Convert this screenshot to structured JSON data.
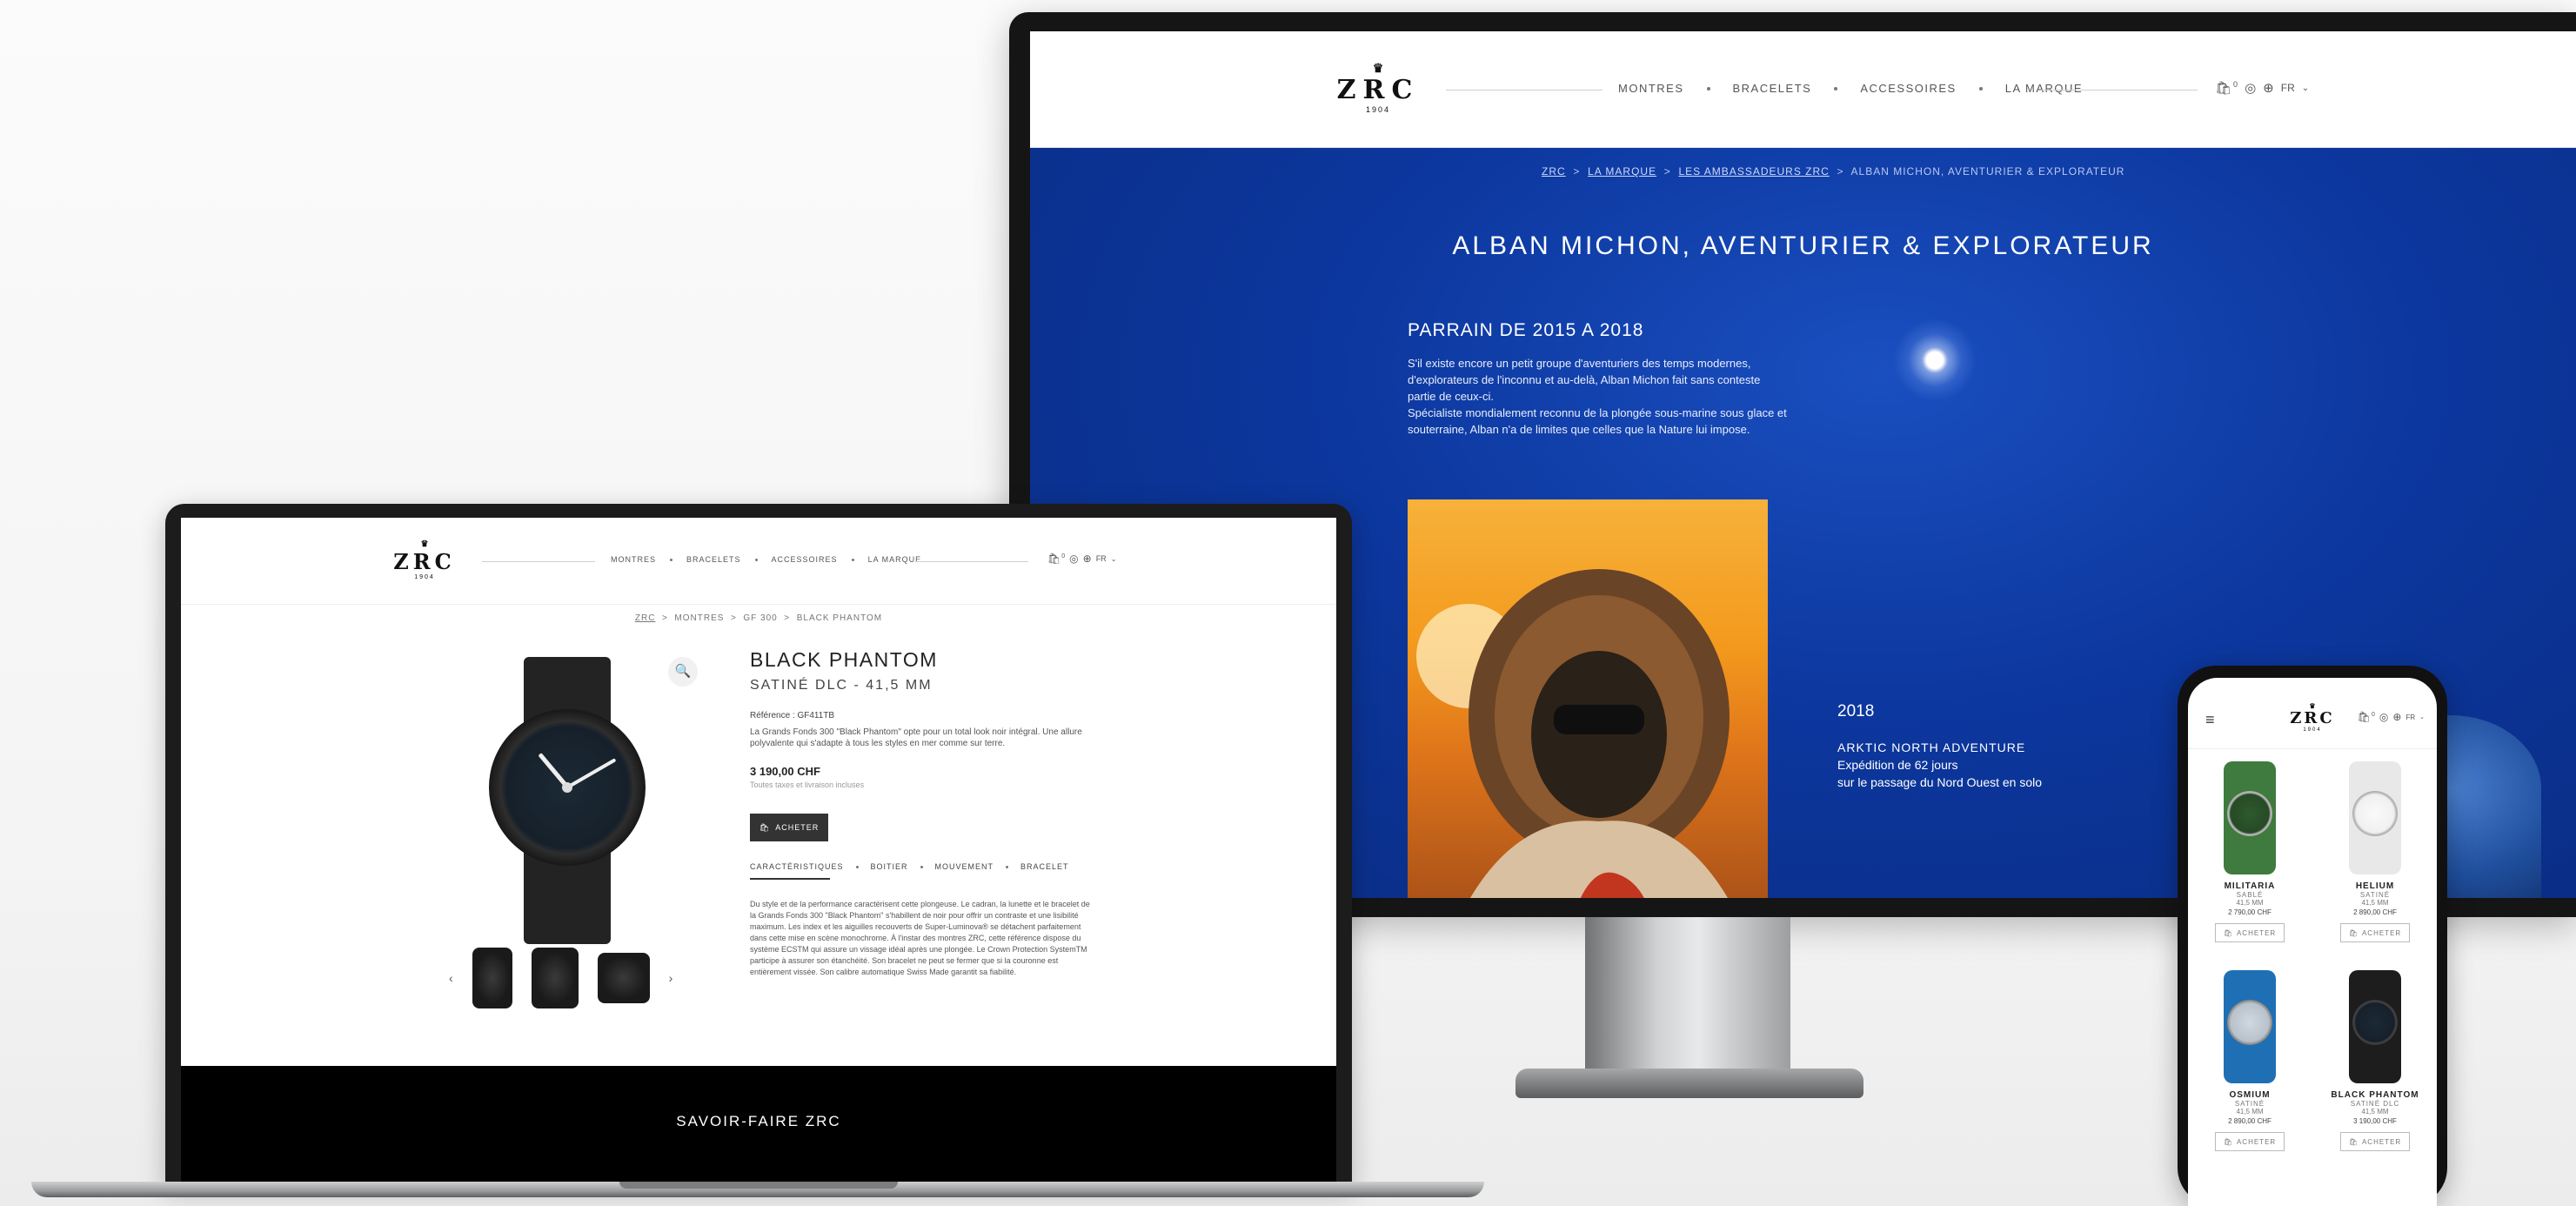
{
  "brand": {
    "logo": "ZRC",
    "year": "1904",
    "crown": "♛"
  },
  "nav": {
    "items": [
      "MONTRES",
      "BRACELETS",
      "ACCESSOIRES",
      "LA MARQUE"
    ],
    "cart_count": "0",
    "lang": "FR"
  },
  "icons": {
    "cart": "bag-icon",
    "account": "user-icon",
    "language": "globe-icon",
    "dropdown": "chevron-down-icon",
    "search": "magnifier-icon",
    "menu": "hamburger-icon"
  },
  "monitor": {
    "breadcrumb": [
      "ZRC",
      "LA MARQUE",
      "LES AMBASSADEURS ZRC",
      "ALBAN MICHON, AVENTURIER & EXPLORATEUR"
    ],
    "title": "ALBAN MICHON, AVENTURIER & EXPLORATEUR",
    "subtitle": "PARRAIN DE 2015 A 2018",
    "para1": "S'il existe encore un petit groupe d'aventuriers des temps modernes, d'explorateurs de l'inconnu et au-delà, Alban Michon fait sans conteste partie de ceux-ci.",
    "para2": "Spécialiste mondialement reconnu de la plongée sous-marine sous glace et souterraine, Alban n'a de limites que celles que la Nature lui impose.",
    "year": "2018",
    "expedition_title": "ARKTIC NORTH ADVENTURE",
    "expedition_line1": "Expédition de 62 jours",
    "expedition_line2": "sur le passage du Nord Ouest en solo"
  },
  "laptop": {
    "breadcrumb": [
      "ZRC",
      "MONTRES",
      "GF 300",
      "BLACK PHANTOM"
    ],
    "product_title": "BLACK PHANTOM",
    "product_subtitle": "SATINÉ DLC - 41,5 MM",
    "reference": "Référence : GF411TB",
    "short_desc": "La Grands Fonds 300 \"Black Phantom\" opte pour un total look noir intégral. Une allure polyvalente qui s'adapte à tous les styles en mer comme sur terre.",
    "price": "3 190,00 CHF",
    "tax_note": "Toutes taxes et livraison incluses",
    "buy_label": "ACHETER",
    "tabs": [
      "CARACTÉRISTIQUES",
      "BOITIER",
      "MOUVEMENT",
      "BRACELET"
    ],
    "long_desc": "Du style et de la performance caractérisent cette plongeuse. Le cadran, la lunette et le bracelet de la Grands Fonds 300 \"Black Phantom\" s'habillent de noir pour offrir un contraste et une lisibilité maximum. Les index et les aiguilles recouverts de Super-Luminova® se détachent parfaitement dans cette mise en scène monochrome. À l'instar des montres ZRC, cette référence dispose du système ECSTM qui assure un vissage idéal après une plongée. Le Crown Protection SystemTM participe à assurer son étanchéité. Son bracelet ne peut se fermer que si la couronne est entièrement vissée. Son calibre automatique Swiss Made garantit sa fiabilité.",
    "footer_title": "SAVOIR-FAIRE ZRC"
  },
  "phone": {
    "products": [
      {
        "name": "MILITARIA",
        "finish": "SABLÉ",
        "size": "41,5 MM",
        "price": "2 790,00 CHF",
        "buy": "ACHETER",
        "color": "#3f7a3e"
      },
      {
        "name": "HELIUM",
        "finish": "SATINÉ",
        "size": "41,5 MM",
        "price": "2 890,00 CHF",
        "buy": "ACHETER",
        "color": "#e8e8e8"
      },
      {
        "name": "OSMIUM",
        "finish": "SATINÉ",
        "size": "41,5 MM",
        "price": "2 890,00 CHF",
        "buy": "ACHETER",
        "color": "#1f6fb5"
      },
      {
        "name": "BLACK PHANTOM",
        "finish": "SATINÉ DLC",
        "size": "41,5 MM",
        "price": "3 190,00 CHF",
        "buy": "ACHETER",
        "color": "#1d1d1d"
      }
    ]
  }
}
